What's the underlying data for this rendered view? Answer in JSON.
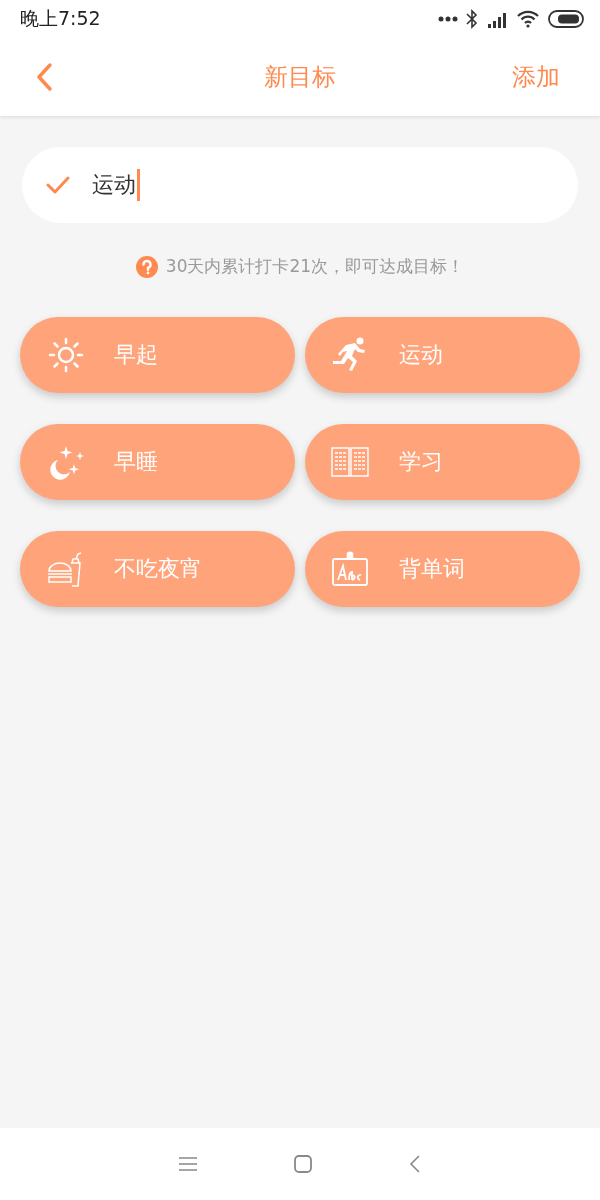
{
  "status_bar": {
    "time": "晚上7:52"
  },
  "nav": {
    "title": "新目标",
    "action": "添加"
  },
  "goal_field": {
    "value": "运动"
  },
  "hint": "30天内累计打卡21次，即可达成目标！",
  "presets": [
    {
      "label": "早起"
    },
    {
      "label": "运动"
    },
    {
      "label": "早睡"
    },
    {
      "label": "学习"
    },
    {
      "label": "不吃夜宵"
    },
    {
      "label": "背单词"
    }
  ]
}
